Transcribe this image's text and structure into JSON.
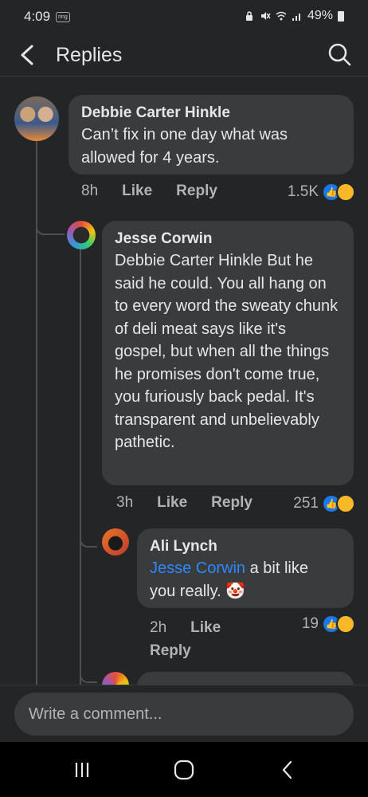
{
  "status_bar": {
    "time": "4:09",
    "ring_label": "ring",
    "battery": "49%"
  },
  "header": {
    "title": "Replies"
  },
  "comments": [
    {
      "author": "Debbie Carter Hinkle",
      "text": "Can’t fix in one day what was allowed for 4 years.",
      "time": "8h",
      "like_label": "Like",
      "reply_label": "Reply",
      "reaction_count": "1.5K"
    },
    {
      "author": "Jesse Corwin",
      "text": "Debbie Carter Hinkle But he said he could. You all hang on to every word the sweaty chunk of deli meat says like it's gospel, but when all the things he promises don't come true, you furiously back pedal. It's transparent and unbelievably pathetic.",
      "time": "3h",
      "like_label": "Like",
      "reply_label": "Reply",
      "reaction_count": "251"
    },
    {
      "author": "Ali Lynch",
      "mention": "Jesse Corwin",
      "text_line1": " a bit like",
      "text_line2": "you really.",
      "emoji": "🤡",
      "time": "2h",
      "like_label": "Like",
      "reply_label": "Reply",
      "reaction_count": "19"
    }
  ],
  "composer": {
    "placeholder": "Write a comment..."
  },
  "nav": {
    "recents": "recents-icon",
    "home": "home-icon",
    "back": "back-icon"
  }
}
